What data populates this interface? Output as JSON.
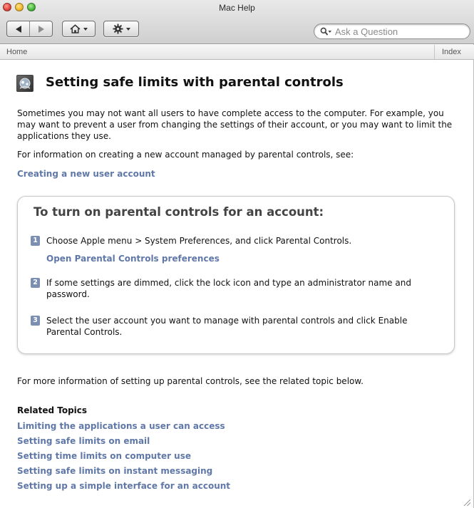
{
  "window": {
    "title": "Mac Help"
  },
  "toolbar": {
    "search": {
      "placeholder": "Ask a Question",
      "value": ""
    }
  },
  "breadcrumb": {
    "home": "Home",
    "index": "Index"
  },
  "article": {
    "title": "Setting safe limits with parental controls",
    "intro": "Sometimes you may not want all users to have complete access to the computer. For example, you may want to prevent a user from changing the settings of their account, or you may want to limit the applications they use.",
    "info_line": "For information on creating a new account managed by parental controls, see:",
    "new_account_link": "Creating a new user account",
    "task": {
      "title": "To turn on parental controls for an account:",
      "steps": [
        {
          "num": "1",
          "text": "Choose Apple menu > System Preferences, and click Parental Controls.",
          "link": "Open Parental Controls preferences"
        },
        {
          "num": "2",
          "text": "If some settings are dimmed, click the lock icon and type an administrator name and password."
        },
        {
          "num": "3",
          "text": "Select the user account you want to manage with parental controls and click Enable Parental Controls."
        }
      ]
    },
    "more_info": "For more information of setting up parental controls, see the related topic below.",
    "related": {
      "heading": "Related Topics",
      "links": [
        "Limiting the applications a user can access",
        "Setting safe limits on email",
        "Setting time limits on computer use",
        "Setting safe limits on instant messaging",
        "Setting up a simple interface for an account"
      ]
    }
  },
  "icons": {
    "back": "back-arrow-icon",
    "forward": "forward-arrow-icon",
    "home": "home-icon",
    "action": "gear-icon",
    "search": "magnifier-icon",
    "page": "parental-controls-icon"
  },
  "colors": {
    "link": "#6078a8",
    "step_badge": "#7b8fb2",
    "task_title": "#444444"
  }
}
